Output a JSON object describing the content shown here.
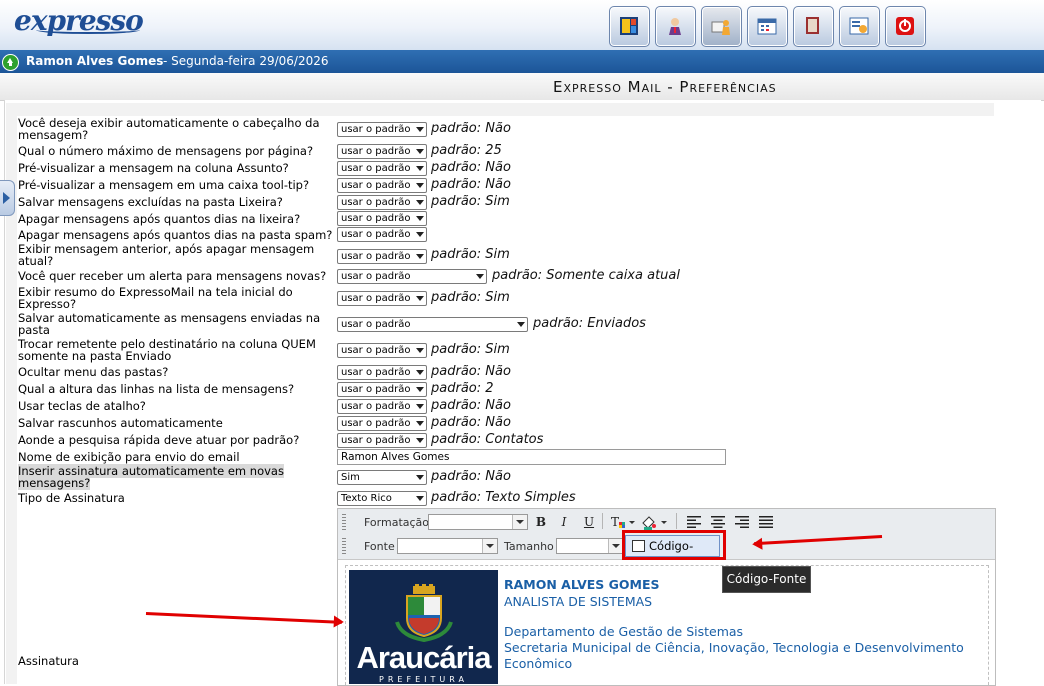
{
  "app": {
    "logo": "expresso",
    "apps": [
      {
        "icon": "layout-icon"
      },
      {
        "icon": "person-icon"
      },
      {
        "icon": "mail-people-icon",
        "active": true
      },
      {
        "icon": "calendar-icon"
      },
      {
        "icon": "book-icon"
      },
      {
        "icon": "settings-icon"
      },
      {
        "icon": "power-icon"
      }
    ]
  },
  "user": {
    "name": "Ramon Alves Gomes",
    "date": "- Segunda-feira 29/06/2026"
  },
  "page_title": "Expresso Mail - Preferências",
  "preferences": [
    {
      "question": "Você deseja exibir automaticamente o cabeçalho da mensagem?",
      "value": "usar o padrão",
      "default": "padrão: Não"
    },
    {
      "question": "Qual o número máximo de mensagens por página?",
      "value": "usar o padrão",
      "default": "padrão: 25"
    },
    {
      "question": "Pré-visualizar a mensagem na coluna Assunto?",
      "value": "usar o padrão",
      "default": "padrão: Não"
    },
    {
      "question": "Pré-visualizar a mensagem em uma caixa tool-tip?",
      "value": "usar o padrão",
      "default": "padrão: Não"
    },
    {
      "question": "Salvar mensagens excluídas na pasta Lixeira?",
      "value": "usar o padrão",
      "default": "padrão: Sim"
    },
    {
      "question": "Apagar mensagens após quantos dias na lixeira?",
      "value": "usar o padrão",
      "default": ""
    },
    {
      "question": "Apagar mensagens após quantos dias na pasta spam?",
      "value": "usar o padrão",
      "default": ""
    },
    {
      "question": "Exibir mensagem anterior, após apagar mensagem atual?",
      "value": "usar o padrão",
      "default": "padrão: Sim"
    },
    {
      "question": "Você quer receber um alerta para mensagens novas?",
      "value": "usar o padrão",
      "default": "padrão: Somente caixa atual"
    },
    {
      "question": "Exibir resumo do ExpressoMail na tela inicial do Expresso?",
      "value": "usar o padrão",
      "default": "padrão: Sim"
    },
    {
      "question": "Salvar automaticamente as mensagens enviadas na pasta",
      "value": "usar o padrão",
      "default": "padrão: Enviados"
    },
    {
      "question": "Trocar remetente pelo destinatário na coluna QUEM somente na pasta Enviado",
      "value": "usar o padrão",
      "default": "padrão: Sim"
    },
    {
      "question": "Ocultar menu das pastas?",
      "value": "usar o padrão",
      "default": "padrão: Não"
    },
    {
      "question": "Qual a altura das linhas na lista de mensagens?",
      "value": "usar o padrão",
      "default": "padrão: 2"
    },
    {
      "question": "Usar teclas de atalho?",
      "value": "usar o padrão",
      "default": "padrão: Não"
    },
    {
      "question": "Salvar rascunhos automaticamente",
      "value": "usar o padrão",
      "default": "padrão: Não"
    },
    {
      "question": "Aonde a pesquisa rápida deve atuar por padrão?",
      "value": "usar o padrão",
      "default": "padrão: Contatos"
    },
    {
      "question": "Nome de exibição para envio do email",
      "value": "Ramon Alves Gomes",
      "default": ""
    },
    {
      "question": "Inserir assinatura automaticamente em novas mensagens?",
      "value": "Sim",
      "default": "padrão: Não"
    },
    {
      "question": "Tipo de Assinatura",
      "value": "Texto Rico",
      "default": "padrão: Texto Simples"
    }
  ],
  "signature_label": "Assinatura",
  "editor": {
    "format_label": "Formatação",
    "font_label": "Fonte",
    "size_label": "Tamanho",
    "bold": "B",
    "italic": "I",
    "underline": "U",
    "source_button": "Código-Fonte",
    "tooltip": "Código-Fonte",
    "signature": {
      "name": "RAMON ALVES GOMES",
      "role": "ANALISTA DE SISTEMAS",
      "dept": "Departamento de Gestão de Sistemas",
      "secretariat": "Secretaria Municipal de Ciência, Inovação, Tecnologia e Desenvolvimento",
      "secretariat2": "Econômico",
      "logo_text": "Araucária",
      "logo_sub": "PREFEITURA"
    }
  },
  "colors": {
    "accent": "#1c5598",
    "annotation": "#e00000",
    "link": "#1a5fa6"
  }
}
